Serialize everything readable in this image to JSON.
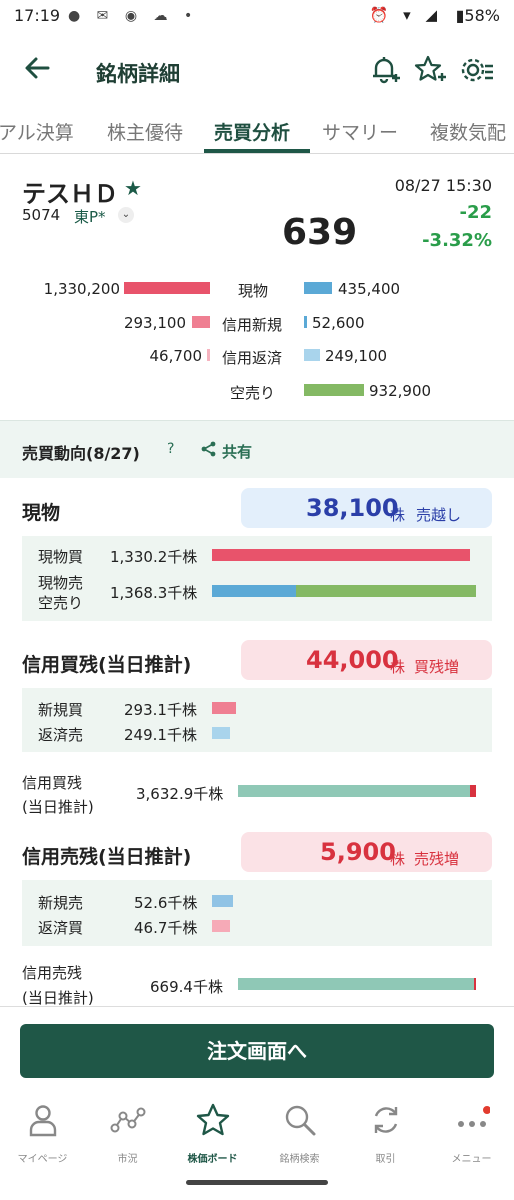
{
  "status_bar": {
    "time": "17:19",
    "left_icons": "● ✉ ◉ ☁ •",
    "right_icons": "⏰ ▾ ◢",
    "battery": "▮58%"
  },
  "header": {
    "title": "銘柄詳細"
  },
  "tabs": [
    "アル決算",
    "株主優待",
    "売買分析",
    "サマリー",
    "複数気配"
  ],
  "active_tab": "売買分析",
  "stock": {
    "name": "テスＨＤ",
    "code": "5074",
    "market": "東P*",
    "datetime": "08/27 15:30",
    "price": "639",
    "change": "-22",
    "change_pct": "-3.32%"
  },
  "quantities": {
    "buy_spot": "1,330,200",
    "sell_spot_label": "現物",
    "sell_spot": "435,400",
    "margin_new_buy": "293,100",
    "margin_new_label": "信用新規",
    "margin_new_sell": "52,600",
    "margin_repay_buy": "46,700",
    "margin_repay_label": "信用返済",
    "margin_repay_sell": "249,100",
    "short_label": "空売り",
    "short_sell": "932,900"
  },
  "trend": {
    "title": "売買動向(8/27)",
    "help": "?",
    "share": "共有"
  },
  "spot": {
    "title": "現物",
    "pill_value": "38,100",
    "pill_unit": "株",
    "pill_note": "売越し",
    "buy_label": "現物買",
    "buy_value": "1,330.2千株",
    "sell_label1": "現物売",
    "sell_label2": "空売り",
    "sell_value": "1,368.3千株"
  },
  "margin_buy": {
    "title": "信用買残(当日推計)",
    "pill_value": "44,000",
    "pill_unit": "株",
    "pill_note": "買残増",
    "new_label": "新規買",
    "new_value": "293.1千株",
    "repay_label": "返済売",
    "repay_value": "249.1千株",
    "total_label1": "信用買残",
    "total_label2": "(当日推計)",
    "total_value": "3,632.9千株"
  },
  "margin_sell": {
    "title": "信用売残(当日推計)",
    "pill_value": "5,900",
    "pill_unit": "株",
    "pill_note": "売残増",
    "new_label": "新規売",
    "new_value": "52.6千株",
    "repay_label": "返済買",
    "repay_value": "46.7千株",
    "total_label1": "信用売残",
    "total_label2": "(当日推計)",
    "total_value": "669.4千株"
  },
  "order_button": "注文画面へ",
  "bottom_nav": [
    {
      "label": "マイページ",
      "icon": "person-icon"
    },
    {
      "label": "市況",
      "icon": "graph-nodes-icon"
    },
    {
      "label": "株価ボード",
      "icon": "star-icon"
    },
    {
      "label": "銘柄検索",
      "icon": "search-icon"
    },
    {
      "label": "取引",
      "icon": "refresh-icon"
    },
    {
      "label": "メニュー",
      "icon": "more-dots-icon"
    }
  ],
  "colors": {
    "brand": "#1f5747",
    "buy_red": "#e8536b",
    "margin_pink": "#ef7f92",
    "spot_blue": "#5ba9d6",
    "light_blue": "#a9d4ec",
    "short_green": "#84b964",
    "balance_teal": "#8fc8b6",
    "up_green": "#2a9d4a"
  }
}
